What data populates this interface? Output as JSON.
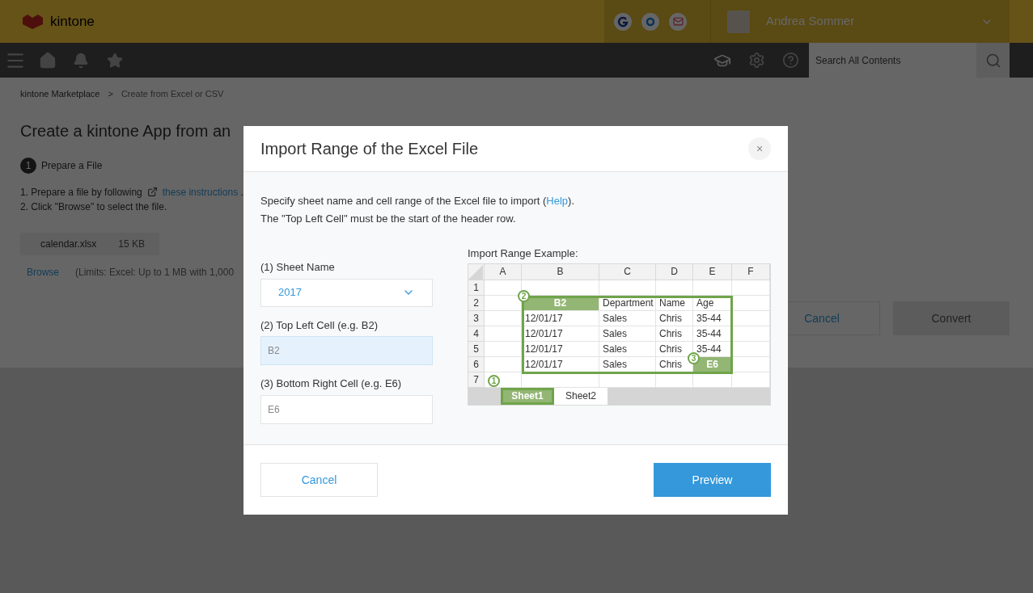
{
  "header": {
    "logo": "kintone",
    "user_name": "Andrea Sommer"
  },
  "nav": {
    "search": {
      "placeholder": "Search All Contents"
    }
  },
  "page": {
    "breadcrumb": [
      {
        "label": "kintone Marketplace",
        "kind": "link"
      },
      {
        "label": ">",
        "kind": "separator"
      },
      {
        "label": "Create from Excel or CSV",
        "kind": "current"
      }
    ],
    "title": "Create a kintone App from an",
    "step": {
      "number": "1",
      "label": "Prepare a File"
    },
    "instructions": [
      {
        "text": "1. Prepare a file by following",
        "link": "these instructions",
        "after": "."
      },
      {
        "text": "2. Click \"Browse\" to select the file."
      }
    ],
    "file": {
      "name": "calendar.xlsx",
      "size": "15 KB"
    },
    "browse": "Browse",
    "limits": "(Limits: Excel: Up to 1 MB with 1,000",
    "buttons": [
      {
        "label": "Cancel",
        "disabled": false
      },
      {
        "label": "Convert",
        "disabled": true
      }
    ]
  },
  "dialog": {
    "title": "Import Range of the Excel File",
    "close": "×",
    "intro": [
      "Specify sheet name and cell range of the Excel file to import (",
      "Help",
      ").",
      "The \"Top Left Cell\" must be the start of the header row."
    ],
    "sheet_name": {
      "label": "(1) Sheet Name",
      "value": "2017"
    },
    "top_left": {
      "label": "(2) Top Left Cell (e.g. B2)",
      "value": "B2",
      "focused": true
    },
    "bottom_right": {
      "label": "(3) Bottom Right Cell (e.g. E6)",
      "value": "E6",
      "focused": false
    },
    "example": {
      "label": "Import Range Example:",
      "columns": [
        "A",
        "B",
        "C",
        "D",
        "E",
        "F"
      ],
      "rows": [
        {
          "label": "1",
          "cells": [
            {
              "text": "",
              "highlighted": false
            },
            {
              "text": "",
              "highlighted": false
            },
            {
              "text": "",
              "highlighted": false
            },
            {
              "text": "",
              "highlighted": false
            },
            {
              "text": "",
              "highlighted": false
            },
            {
              "text": "",
              "highlighted": false
            }
          ]
        },
        {
          "label": "2",
          "cells": [
            {
              "text": "",
              "highlighted": false
            },
            {
              "text": "B2",
              "highlighted": true
            },
            {
              "text": "Department",
              "highlighted": false
            },
            {
              "text": "Name",
              "highlighted": false
            },
            {
              "text": "Age",
              "highlighted": false
            },
            {
              "text": "",
              "highlighted": false
            }
          ]
        },
        {
          "label": "3",
          "cells": [
            {
              "text": "",
              "highlighted": false
            },
            {
              "text": "12/01/17",
              "highlighted": false
            },
            {
              "text": "Sales",
              "highlighted": false
            },
            {
              "text": "Chris",
              "highlighted": false
            },
            {
              "text": "35-44",
              "highlighted": false
            },
            {
              "text": "",
              "highlighted": false
            }
          ]
        },
        {
          "label": "4",
          "cells": [
            {
              "text": "",
              "highlighted": false
            },
            {
              "text": "12/01/17",
              "highlighted": false
            },
            {
              "text": "Sales",
              "highlighted": false
            },
            {
              "text": "Chris",
              "highlighted": false
            },
            {
              "text": "35-44",
              "highlighted": false
            },
            {
              "text": "",
              "highlighted": false
            }
          ]
        },
        {
          "label": "5",
          "cells": [
            {
              "text": "",
              "highlighted": false
            },
            {
              "text": "12/01/17",
              "highlighted": false
            },
            {
              "text": "Sales",
              "highlighted": false
            },
            {
              "text": "Chris",
              "highlighted": false
            },
            {
              "text": "35-44",
              "highlighted": false
            },
            {
              "text": "",
              "highlighted": false
            }
          ]
        },
        {
          "label": "6",
          "cells": [
            {
              "text": "",
              "highlighted": false
            },
            {
              "text": "12/01/17",
              "highlighted": false
            },
            {
              "text": "Sales",
              "highlighted": false
            },
            {
              "text": "Chris",
              "highlighted": false
            },
            {
              "text": "E6",
              "highlighted": true
            },
            {
              "text": "",
              "highlighted": false
            }
          ]
        },
        {
          "label": "7",
          "cells": [
            {
              "text": "",
              "highlighted": false
            },
            {
              "text": "",
              "highlighted": false
            },
            {
              "text": "",
              "highlighted": false
            },
            {
              "text": "",
              "highlighted": false
            },
            {
              "text": "",
              "highlighted": false
            },
            {
              "text": "",
              "highlighted": false
            }
          ]
        }
      ],
      "sheets": [
        {
          "label": "Sheet1",
          "selected": true
        },
        {
          "label": "Sheet2",
          "selected": false
        }
      ],
      "markers": [
        {
          "number": "1",
          "kind": "sheet"
        },
        {
          "number": "2",
          "kind": "start"
        },
        {
          "number": "3",
          "kind": "end"
        }
      ]
    },
    "buttons": [
      {
        "label": "Cancel",
        "kind": "secondary"
      },
      {
        "label": "Preview",
        "kind": "primary"
      }
    ]
  }
}
